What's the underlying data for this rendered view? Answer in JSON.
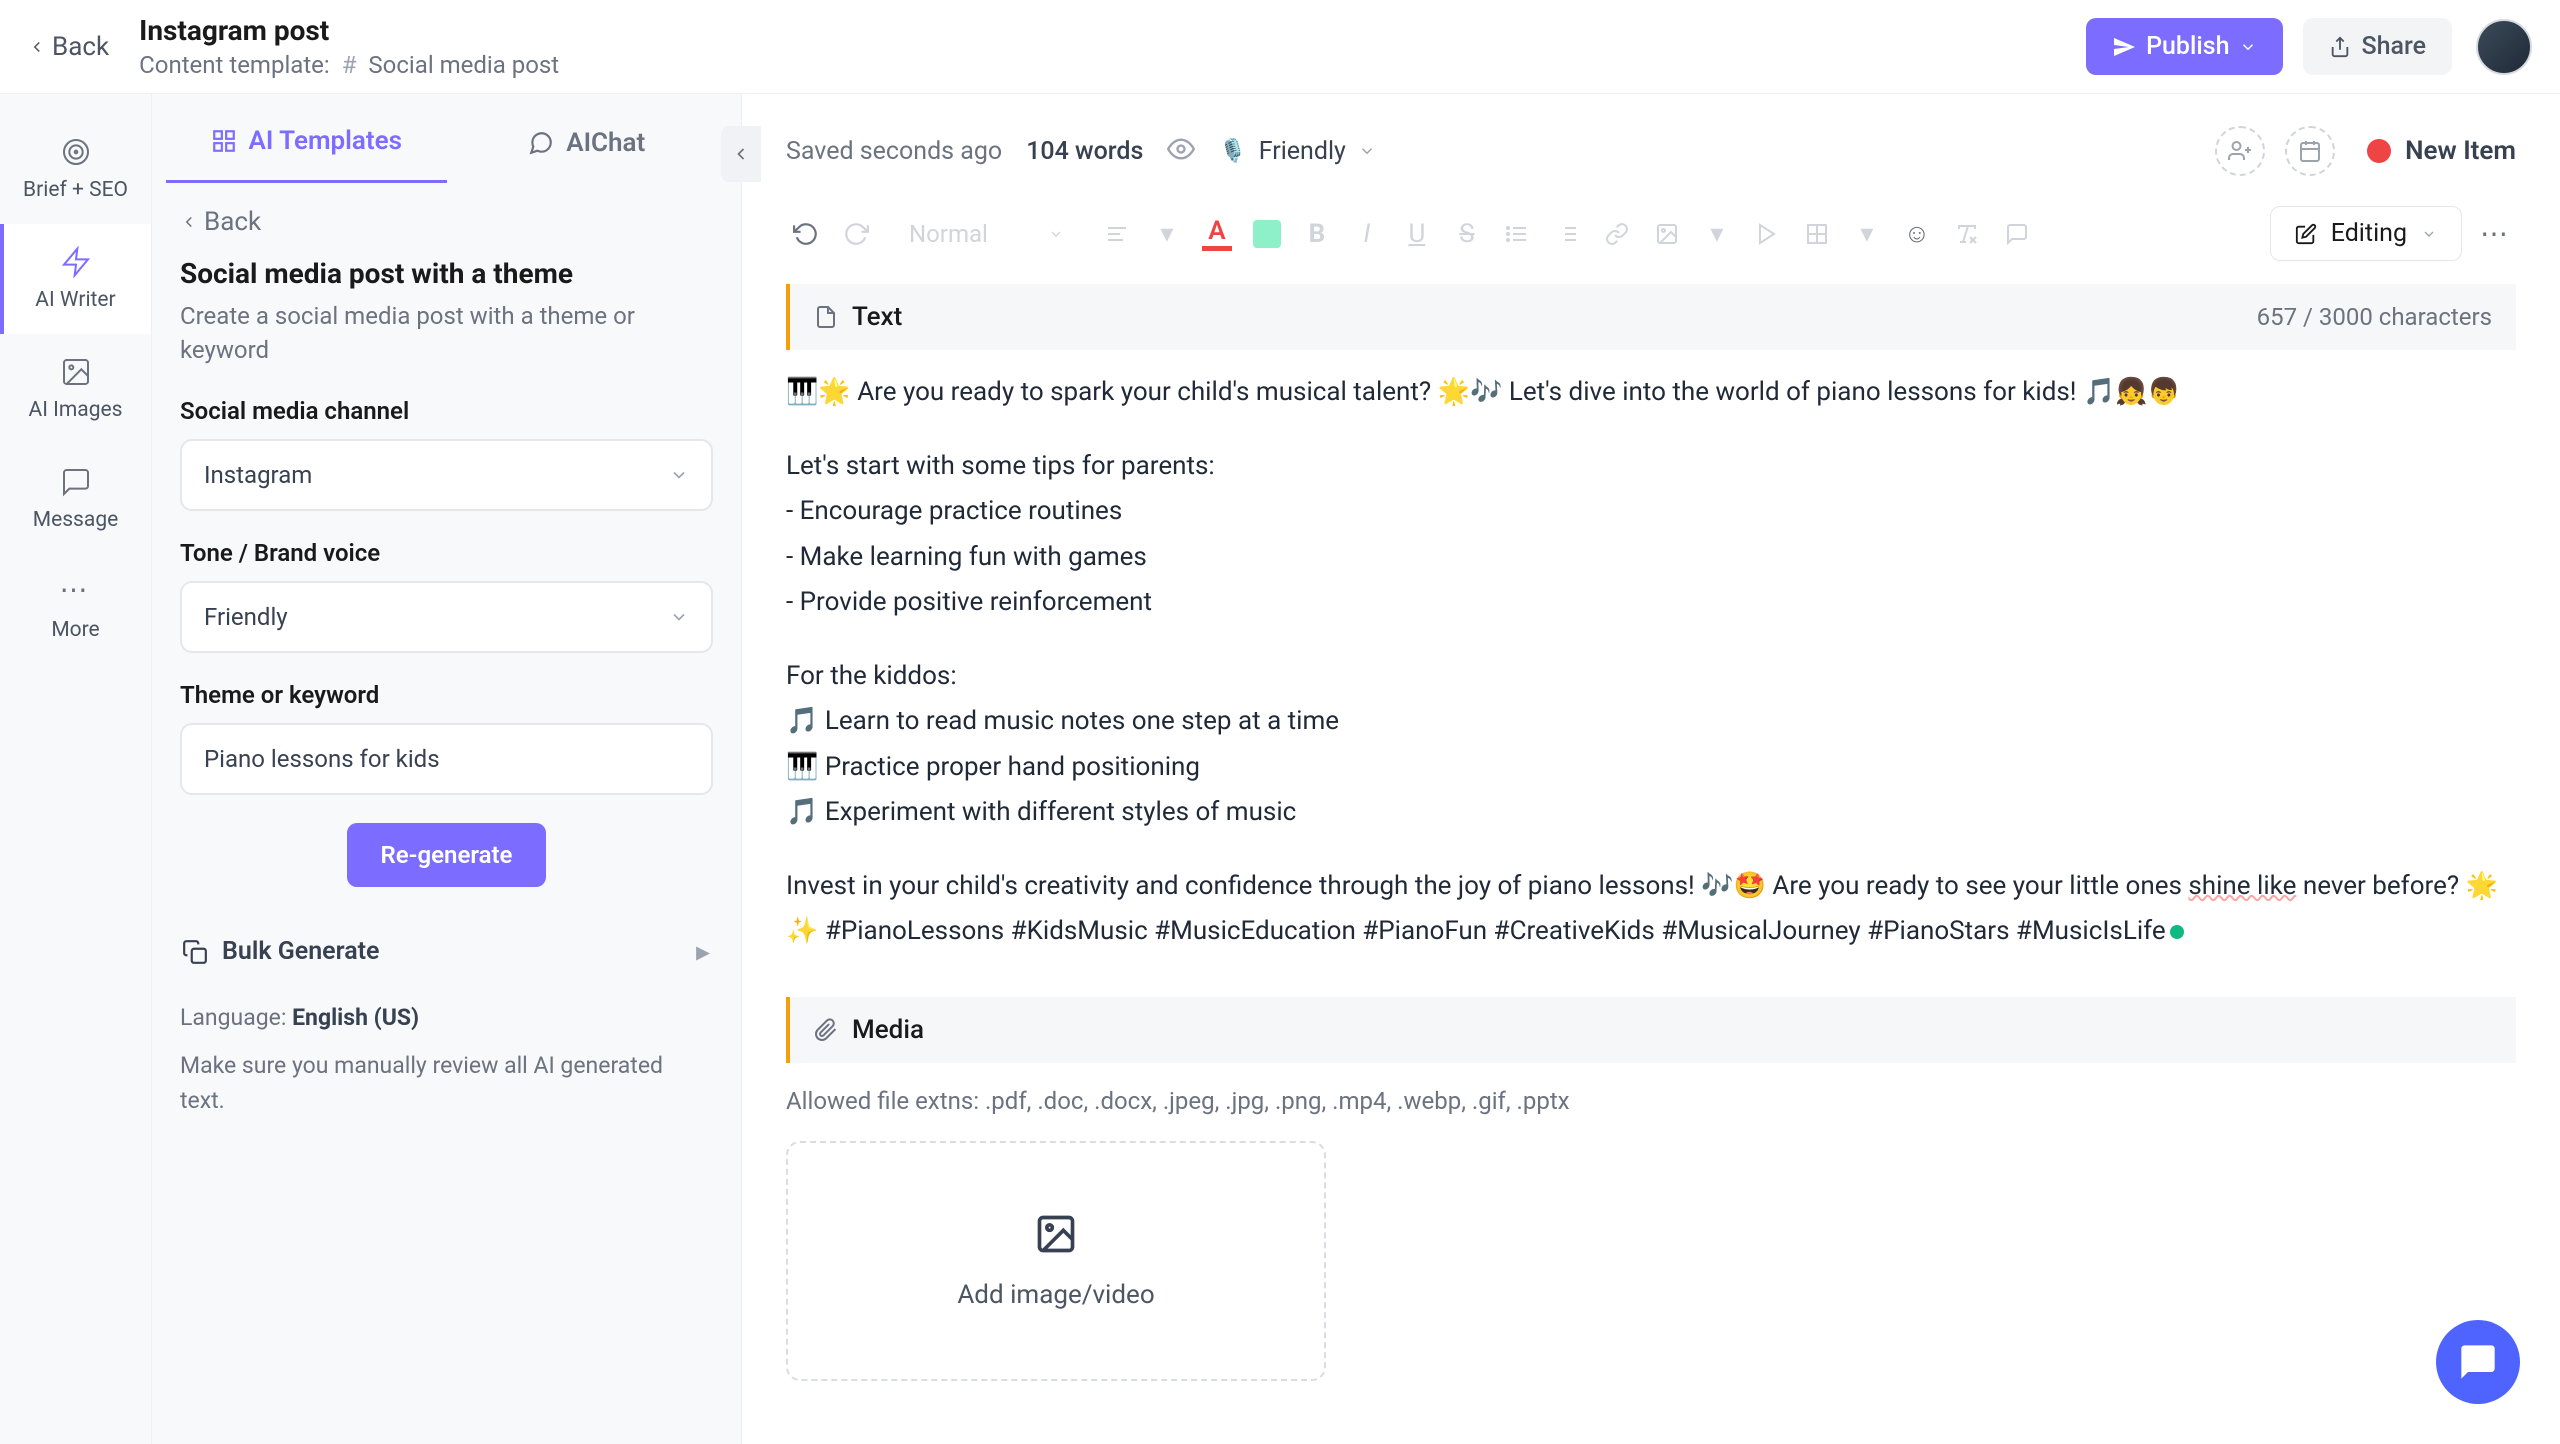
{
  "top": {
    "back": "Back",
    "title": "Instagram post",
    "template_label": "Content template:",
    "template_name": "Social media post",
    "publish": "Publish",
    "share": "Share"
  },
  "rail": {
    "brief": "Brief + SEO",
    "writer": "AI Writer",
    "images": "AI Images",
    "message": "Message",
    "more": "More"
  },
  "panel": {
    "tab_templates": "AI Templates",
    "tab_chat": "AIChat",
    "back": "Back",
    "title": "Social media post with a theme",
    "desc": "Create a social media post with a theme or keyword",
    "channel_label": "Social media channel",
    "channel_value": "Instagram",
    "tone_label": "Tone / Brand voice",
    "tone_value": "Friendly",
    "theme_label": "Theme or keyword",
    "theme_value": "Piano lessons for kids",
    "regen": "Re-generate",
    "bulk": "Bulk Generate",
    "language_label": "Language:",
    "language_value": "English (US)",
    "review_note": "Make sure you manually review all AI generated text."
  },
  "editor": {
    "saved": "Saved seconds ago",
    "words": "104 words",
    "tone": "Friendly",
    "status": "New Item",
    "style": "Normal",
    "editing": "Editing",
    "text_section": "Text",
    "char_count": "657 / 3000 characters",
    "paragraphs": {
      "p1": "🎹🌟 Are you ready to spark your child's musical talent? 🌟🎶 Let's dive into the world of piano lessons for kids! 🎵👧👦",
      "p2": "Let's start with some tips for parents:",
      "p2a": "- Encourage practice routines",
      "p2b": "- Make learning fun with games",
      "p2c": "- Provide positive reinforcement",
      "p3": "For the kiddos:",
      "p3a": "🎵 Learn to read music notes one step at a time",
      "p3b": "🎹 Practice proper hand positioning",
      "p3c": "🎵 Experiment with different styles of music",
      "p4a": "Invest in your child's creativity and confidence through the joy of piano lessons! 🎶🤩 Are you ready to see your little ones ",
      "p4b": "shine like",
      "p4c": " never before? 🌟✨ #PianoLessons #KidsMusic #MusicEducation #PianoFun #CreativeKids #MusicalJourney #PianoStars #MusicIsLife"
    },
    "media_section": "Media",
    "allowed": "Allowed file extns: .pdf, .doc, .docx, .jpeg, .jpg, .png, .mp4, .webp, .gif, .pptx",
    "add_media": "Add image/video"
  }
}
